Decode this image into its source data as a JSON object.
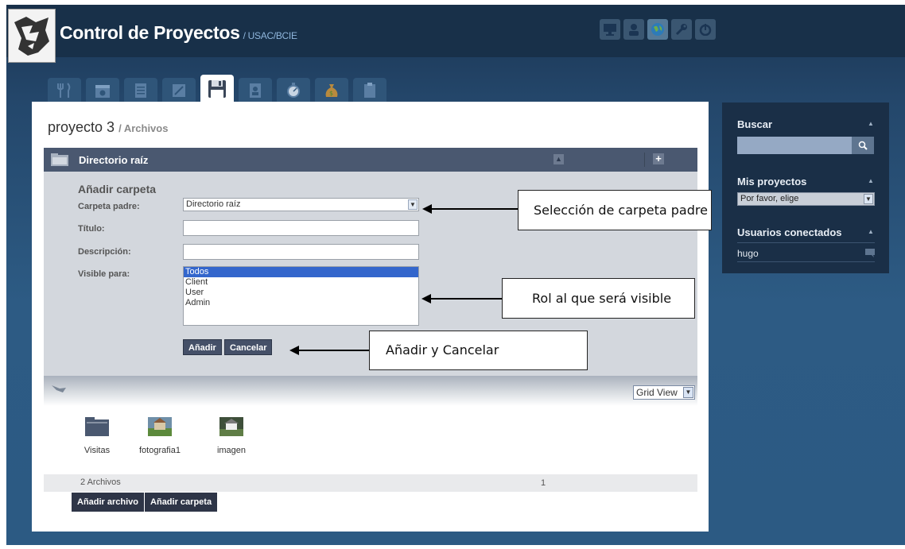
{
  "header": {
    "app_title": "Control de Proyectos",
    "app_subtitle": "/ USAC/BCIE"
  },
  "page": {
    "project": "proyecto 3",
    "section": "/ Archivos"
  },
  "directory_bar": {
    "title": "Directorio raíz"
  },
  "form": {
    "heading": "Añadir carpeta",
    "parent_label": "Carpeta padre:",
    "parent_value": "Directorio raíz",
    "title_label": "Título:",
    "description_label": "Descripción:",
    "visible_label": "Visible para:",
    "visible_options": [
      "Todos",
      "Client",
      "User",
      "Admin"
    ],
    "add_button": "Añadir",
    "cancel_button": "Cancelar"
  },
  "file_browser": {
    "view_select": "Grid View",
    "items": [
      {
        "name": "Visitas",
        "icon": "folder-icon"
      },
      {
        "name": "fotografia1",
        "icon": "photo-icon"
      },
      {
        "name": "imagen",
        "icon": "photo-icon"
      }
    ],
    "count_text": "2 Archivos",
    "page": "1",
    "add_file_button": "Añadir archivo",
    "add_folder_button": "Añadir carpeta"
  },
  "sidebar": {
    "search_title": "Buscar",
    "projects_title": "Mis proyectos",
    "projects_select": "Por favor, elige",
    "users_title": "Usuarios conectados",
    "users": [
      "hugo"
    ]
  },
  "annotations": {
    "parent_callout": "Selección de carpeta padre",
    "role_callout": "Rol al que será visible",
    "buttons_callout": "Añadir y Cancelar"
  },
  "colors": {
    "background": "#2c5a83",
    "topbar": "#183049",
    "panel_header": "#4a5870",
    "form_bg": "#d3d7dd",
    "sidebar": "#1a2f47",
    "selected_option": "#3366cc"
  }
}
